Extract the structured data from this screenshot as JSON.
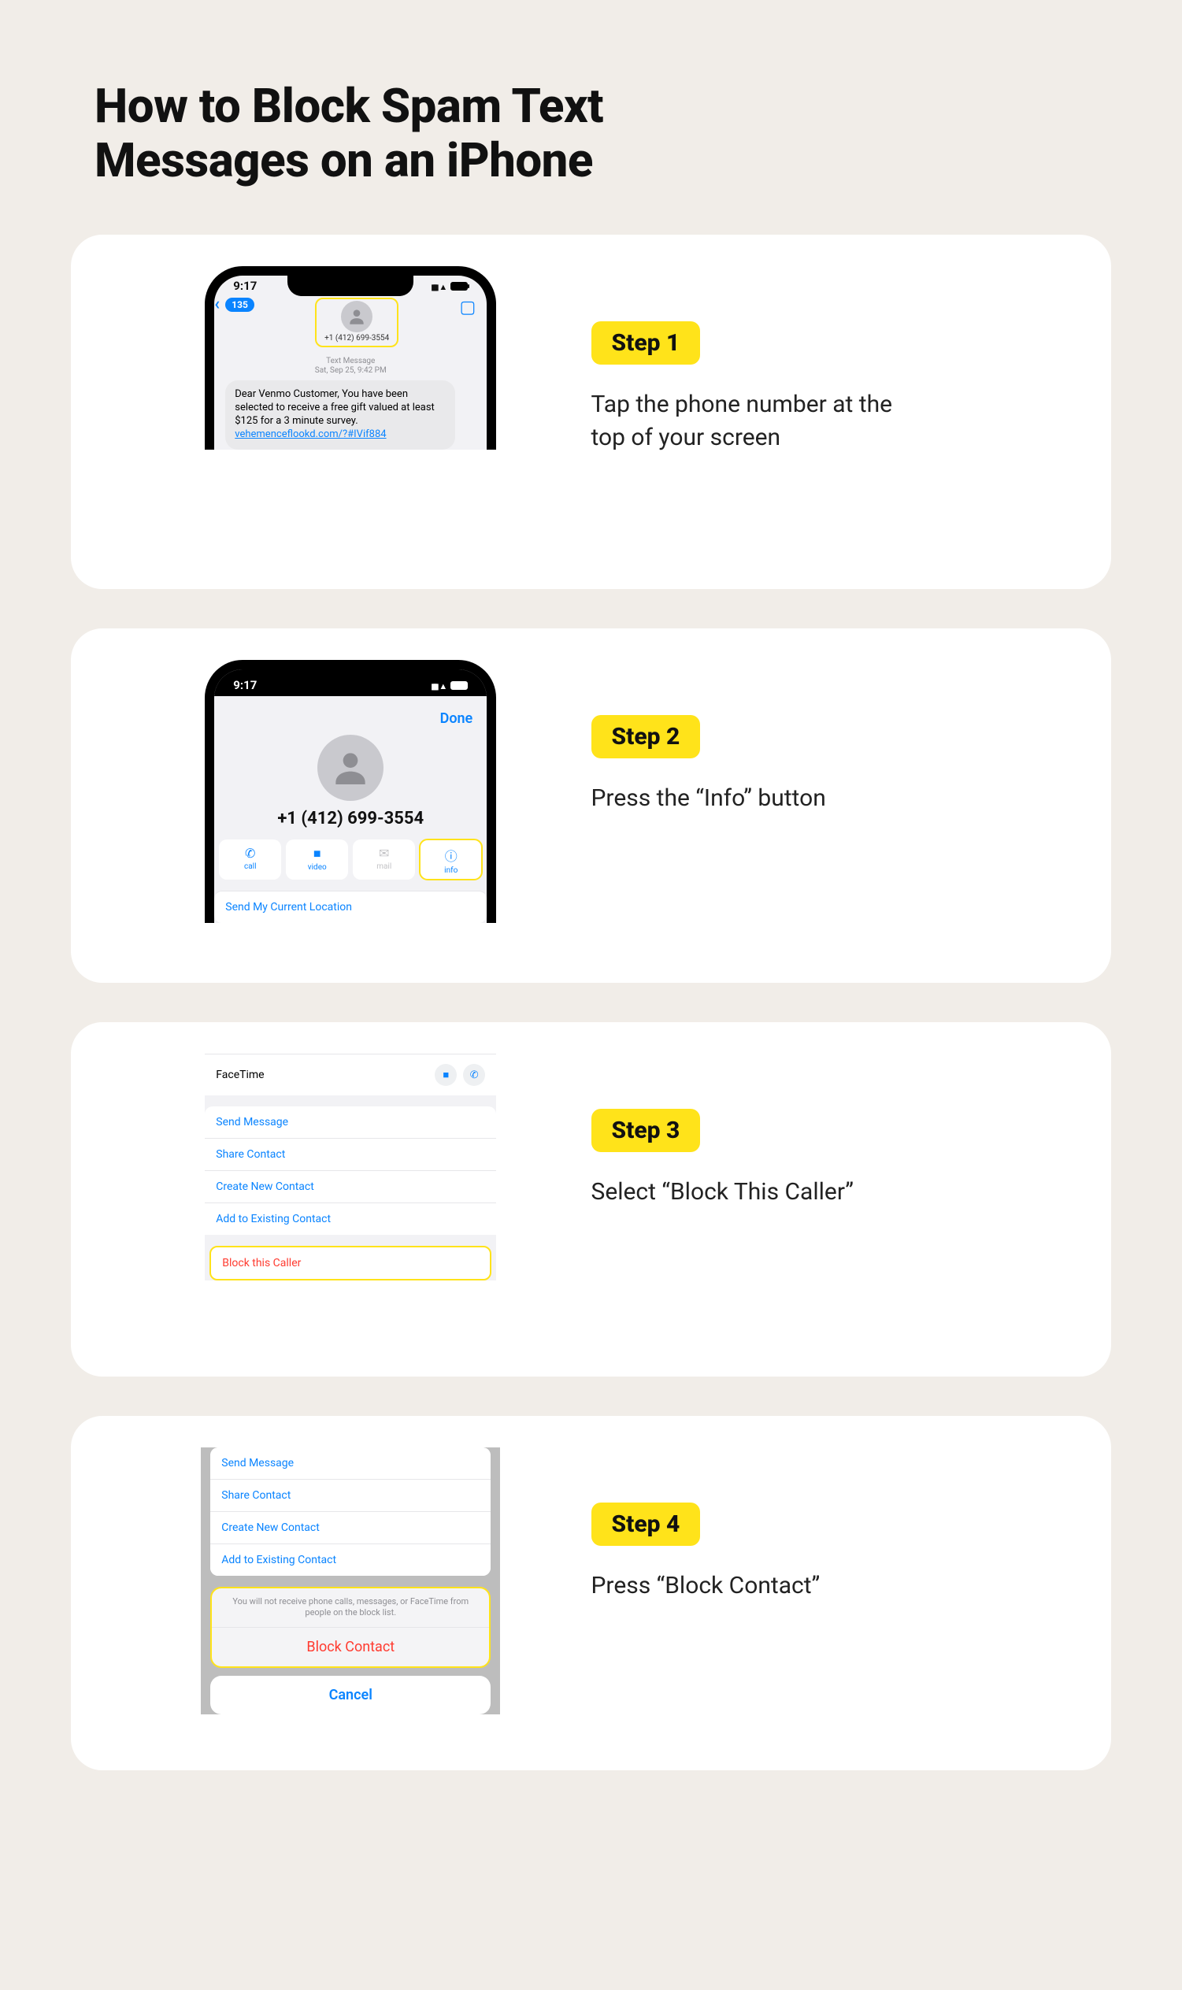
{
  "title": "How to Block Spam Text Messages on an iPhone",
  "status": {
    "time": "9:17"
  },
  "steps": [
    {
      "badge": "Step 1",
      "desc": "Tap the phone number at the top of your screen"
    },
    {
      "badge": "Step 2",
      "desc": "Press the “Info” button"
    },
    {
      "badge": "Step 3",
      "desc": "Select “Block This Caller”"
    },
    {
      "badge": "Step 4",
      "desc": "Press “Block Contact”"
    }
  ],
  "screen1": {
    "back_count": "135",
    "phone_number": "+1 (412) 699-3554",
    "meta_line1": "Text Message",
    "meta_line2": "Sat, Sep 25, 9:42 PM",
    "message": "Dear Venmo Customer, You have been selected to receive a free gift valued at least $125 for a 3 minute survey.",
    "link": "vehemenceflookd.com/?#IVif884"
  },
  "screen2": {
    "done": "Done",
    "phone_number": "+1 (412) 699-3554",
    "actions": [
      {
        "label": "call"
      },
      {
        "label": "video"
      },
      {
        "label": "mail"
      },
      {
        "label": "info"
      }
    ],
    "send_location": "Send My Current Location"
  },
  "screen3": {
    "facetime": "FaceTime",
    "rows": [
      "Send Message",
      "Share Contact",
      "Create New Contact",
      "Add to Existing Contact"
    ],
    "block": "Block this Caller"
  },
  "screen4": {
    "rows": [
      "Send Message",
      "Share Contact",
      "Create New Contact",
      "Add to Existing Contact"
    ],
    "sheet_msg": "You will not receive phone calls, messages, or FaceTime from people on the block list.",
    "block": "Block Contact",
    "cancel": "Cancel"
  }
}
